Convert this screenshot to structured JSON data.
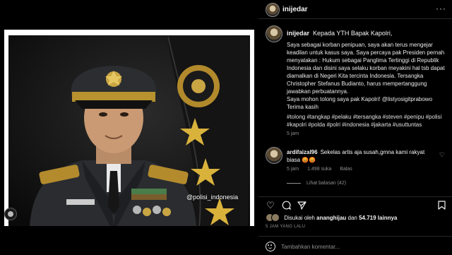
{
  "post": {
    "watermark": "@polisi_indonesia"
  },
  "header": {
    "username": "inijedar",
    "more": "···"
  },
  "caption": {
    "username": "inijedar",
    "lead": "Kepada YTH Bapak Kapolri,",
    "para1": "Saya sebagai korban penipuan, saya akan terus mengejar keadilan untuk kasus saya. Saya percaya pak Presiden pernah menyatakan : Hukum sebagai Panglima Tertinggi di Republik Indonesia dan disini saya selaku korban meyakini hal tsb dapat diamalkan di Negeri Kita tercinta Indonesia. Tersangka Christopher Stefanus Budianto, harus mempertanggung jawabkan perbuatannya.",
    "para2": "Saya mohon tolong saya pak Kapolri! @listyosigitprabowo",
    "para3": "Terima kasih",
    "hashtags": "#tolong #tangkap #pelaku #tersangka #steven #penipu #polisi #kapolri #polda #polri #indonesia #jakarta #usuttuntas",
    "time": "5 jam"
  },
  "comment": {
    "username": "ardifaizal96",
    "text": "Sekelas artis aja susah,gmna kami rakyat biasa 😡😡",
    "time": "5 jam",
    "likes": "1.498 suka",
    "reply": "Balas",
    "view_replies": "Lihat balasan (42)"
  },
  "likes": {
    "prefix": "Disukai oleh",
    "user": "ananghijau",
    "middle": "dan",
    "count": "54.719 lainnya"
  },
  "posted_time": "5 JAM YANG LALU",
  "add_comment": {
    "placeholder": "Tambahkan komentar..."
  }
}
